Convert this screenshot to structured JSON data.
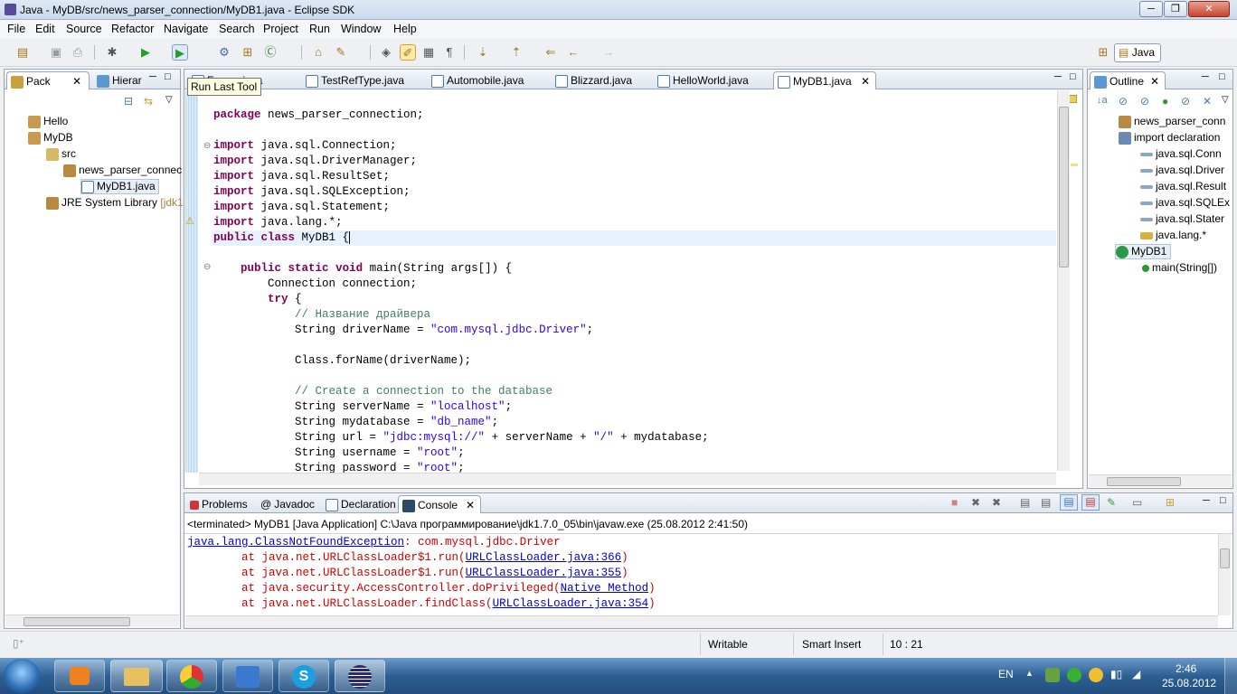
{
  "window": {
    "title": "Java - MyDB/src/news_parser_connection/MyDB1.java - Eclipse SDK"
  },
  "menu": [
    "File",
    "Edit",
    "Source",
    "Refactor",
    "Navigate",
    "Search",
    "Project",
    "Run",
    "Window",
    "Help"
  ],
  "perspective": {
    "label": "Java"
  },
  "tooltip": "Run Last Tool",
  "left_panel": {
    "tabs": [
      "Pack",
      "Hierar"
    ],
    "tree": [
      {
        "label": "Hello",
        "depth": 0
      },
      {
        "label": "MyDB",
        "depth": 0
      },
      {
        "label": "src",
        "depth": 1
      },
      {
        "label": "news_parser_connec",
        "depth": 2
      },
      {
        "label": "MyDB1.java",
        "depth": 3
      },
      {
        "label": "JRE System Library",
        "suffix": "[jdk1.",
        "depth": 1
      }
    ]
  },
  "editor": {
    "tabs": [
      "TestRefType.java",
      "Automobile.java",
      "Blizzard.java",
      "HelloWorld.java",
      "MyDB1.java"
    ],
    "first_tab_partial": "F..........java"
  },
  "code": [
    [
      [
        "kw",
        "package"
      ],
      [
        "t",
        " news_parser_connection;"
      ]
    ],
    [],
    [
      [
        "kw",
        "import"
      ],
      [
        "t",
        " java.sql.Connection;"
      ]
    ],
    [
      [
        "kw",
        "import"
      ],
      [
        "t",
        " java.sql.DriverManager;"
      ]
    ],
    [
      [
        "kw",
        "import"
      ],
      [
        "t",
        " java.sql.ResultSet;"
      ]
    ],
    [
      [
        "kw",
        "import"
      ],
      [
        "t",
        " java.sql.SQLException;"
      ]
    ],
    [
      [
        "kw",
        "import"
      ],
      [
        "t",
        " java.sql.Statement;"
      ]
    ],
    [
      [
        "kw",
        "import"
      ],
      [
        "t",
        " java.lang.*;"
      ]
    ],
    [
      [
        "kw",
        "public"
      ],
      [
        "t",
        " "
      ],
      [
        "kw",
        "class"
      ],
      [
        "t",
        " MyDB1 {"
      ]
    ],
    [],
    [
      [
        "t",
        "    "
      ],
      [
        "kw",
        "public"
      ],
      [
        "t",
        " "
      ],
      [
        "kw",
        "static"
      ],
      [
        "t",
        " "
      ],
      [
        "kw",
        "void"
      ],
      [
        "t",
        " main(String args[]) {"
      ]
    ],
    [
      [
        "t",
        "        Connection connection;"
      ]
    ],
    [
      [
        "t",
        "        "
      ],
      [
        "kw",
        "try"
      ],
      [
        "t",
        " {"
      ]
    ],
    [
      [
        "t",
        "            "
      ],
      [
        "cm",
        "// Название драйвера"
      ]
    ],
    [
      [
        "t",
        "            String driverName = "
      ],
      [
        "str",
        "\"com.mysql.jdbc.Driver\""
      ],
      [
        "t",
        ";"
      ]
    ],
    [],
    [
      [
        "t",
        "            Class.forName(driverName);"
      ]
    ],
    [],
    [
      [
        "t",
        "            "
      ],
      [
        "cm",
        "// Create a connection to the database"
      ]
    ],
    [
      [
        "t",
        "            String serverName = "
      ],
      [
        "str",
        "\"localhost\""
      ],
      [
        "t",
        ";"
      ]
    ],
    [
      [
        "t",
        "            String mydatabase = "
      ],
      [
        "str",
        "\"db_name\""
      ],
      [
        "t",
        ";"
      ]
    ],
    [
      [
        "t",
        "            String url = "
      ],
      [
        "str",
        "\"jdbc:mysql://\""
      ],
      [
        "t",
        " + serverName + "
      ],
      [
        "str",
        "\"/\""
      ],
      [
        "t",
        " + mydatabase;"
      ]
    ],
    [
      [
        "t",
        "            String username = "
      ],
      [
        "str",
        "\"root\""
      ],
      [
        "t",
        ";"
      ]
    ],
    [
      [
        "t",
        "            String password = "
      ],
      [
        "str",
        "\"root\""
      ],
      [
        "t",
        ";"
      ]
    ]
  ],
  "outline": {
    "tab": "Outline",
    "items": [
      {
        "label": "news_parser_conn",
        "depth": 0
      },
      {
        "label": "import declaration",
        "depth": 0
      },
      {
        "label": "java.sql.Conn",
        "depth": 1
      },
      {
        "label": "java.sql.Driver",
        "depth": 1
      },
      {
        "label": "java.sql.Result",
        "depth": 1
      },
      {
        "label": "java.sql.SQLEx",
        "depth": 1
      },
      {
        "label": "java.sql.Stater",
        "depth": 1
      },
      {
        "label": "java.lang.*",
        "depth": 1
      },
      {
        "label": "MyDB1",
        "depth": 0
      },
      {
        "label": "main(String[])",
        "depth": 1
      }
    ]
  },
  "bottom": {
    "tabs": [
      "Problems",
      "Javadoc",
      "Declaration",
      "Console"
    ],
    "terminated": "<terminated> MyDB1 [Java Application] C:\\Java программирование\\jdk1.7.0_05\\bin\\javaw.exe (25.08.2012 2:41:50)",
    "console": [
      {
        "pre": "",
        "link": "java.lang.ClassNotFoundException",
        "post": ": com.mysql.jdbc.Driver"
      },
      {
        "pre": "\tat java.net.URLClassLoader$1.run(",
        "link": "URLClassLoader.java:366",
        "post": ")"
      },
      {
        "pre": "\tat java.net.URLClassLoader$1.run(",
        "link": "URLClassLoader.java:355",
        "post": ")"
      },
      {
        "pre": "\tat java.security.AccessController.doPrivileged(",
        "link": "Native Method",
        "post": ")"
      },
      {
        "pre": "\tat java.net.URLClassLoader.findClass(",
        "link": "URLClassLoader.java:354",
        "post": ")"
      }
    ]
  },
  "status": {
    "writable": "Writable",
    "insert": "Smart Insert",
    "position": "10 : 21"
  },
  "taskbar": {
    "lang": "EN",
    "time": "2:46",
    "date": "25.08.2012"
  }
}
